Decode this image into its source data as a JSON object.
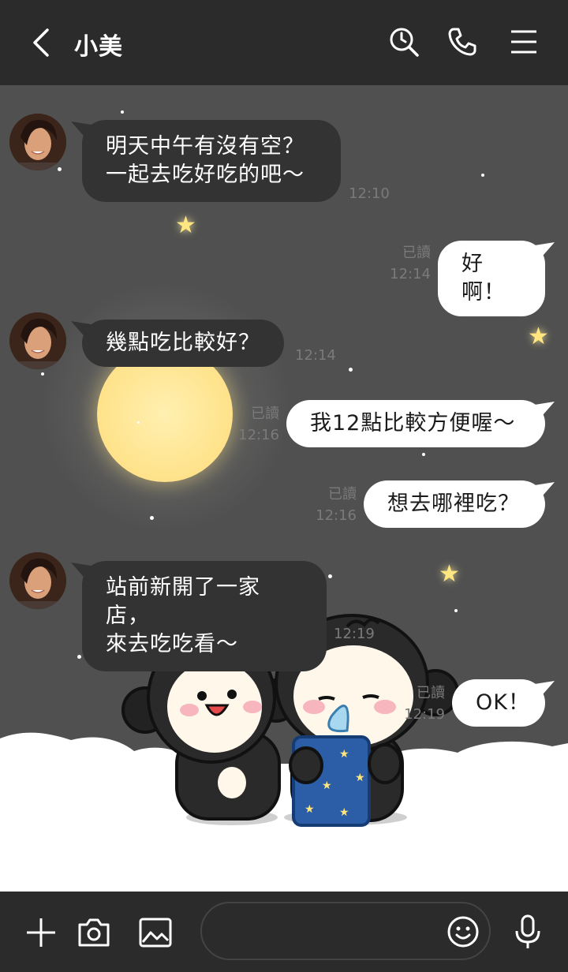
{
  "header": {
    "title": "小美"
  },
  "icons": {
    "back": "chevron-left-icon",
    "history": "clock-search-icon",
    "call": "phone-icon",
    "menu": "hamburger-menu-icon",
    "add": "plus-icon",
    "camera": "camera-icon",
    "image": "image-icon",
    "emoji": "emoji-icon",
    "mic": "microphone-icon"
  },
  "colors": {
    "header_bg": "#2b2b2b",
    "chat_bg": "#505050",
    "incoming_bubble": "#333333",
    "outgoing_bubble": "#ffffff",
    "meta_text": "#7a7a7a"
  },
  "messages": [
    {
      "side": "in",
      "text": "明天中午有沒有空？\n一起去吃好吃的吧～",
      "time": "12:10"
    },
    {
      "side": "out",
      "text": "好啊！",
      "read": "已讀",
      "time": "12:14"
    },
    {
      "side": "in",
      "text": "幾點吃比較好？",
      "time": "12:14"
    },
    {
      "side": "out",
      "text": "我12點比較方便喔～",
      "read": "已讀",
      "time": "12:16"
    },
    {
      "side": "out",
      "text": "想去哪裡吃？",
      "read": "已讀",
      "time": "12:16"
    },
    {
      "side": "in",
      "text": "站前新開了一家店，\n來去吃吃看～",
      "time": "12:19"
    },
    {
      "side": "out",
      "text": "OK！",
      "read": "已讀",
      "time": "12:19"
    }
  ],
  "input": {
    "placeholder": ""
  }
}
